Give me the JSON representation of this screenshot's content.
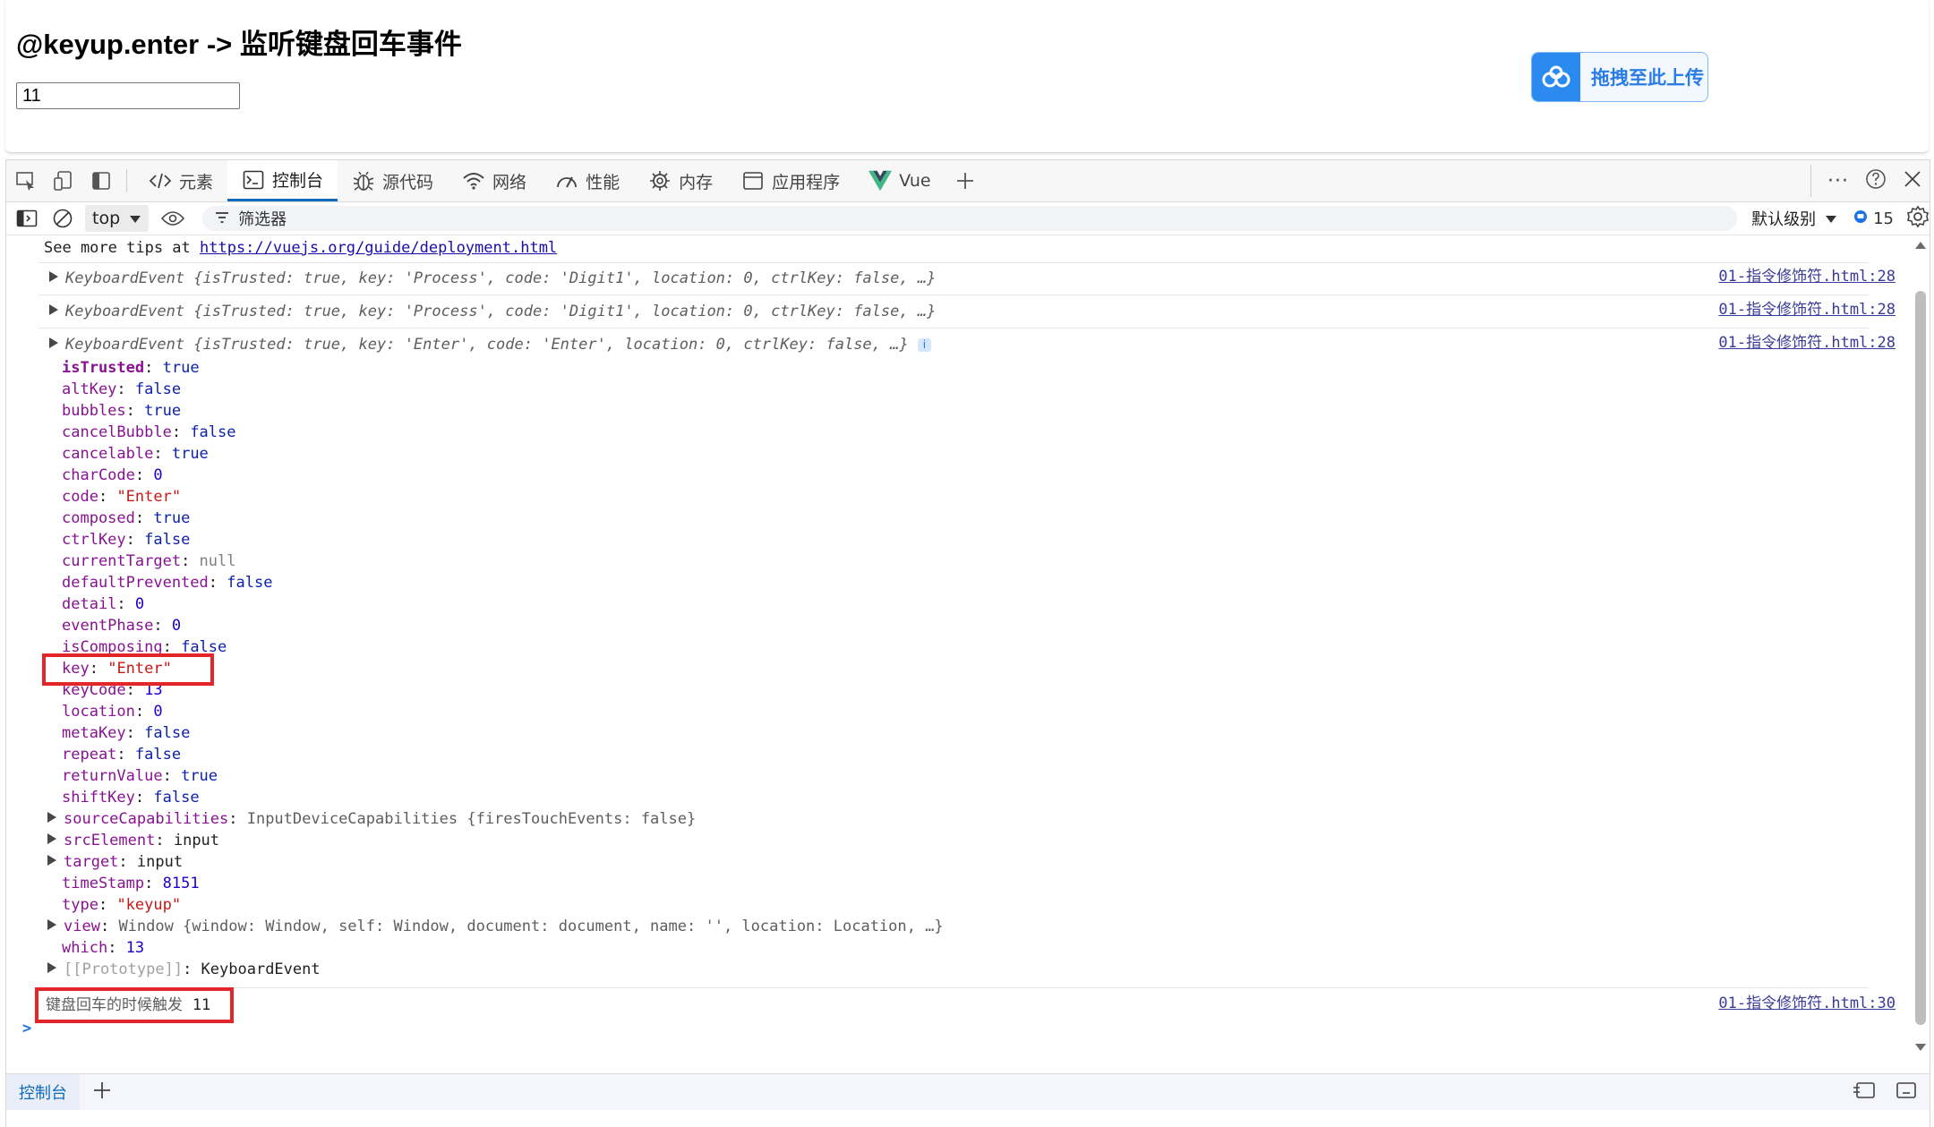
{
  "page": {
    "title": "@keyup.enter -> 监听键盘回车事件",
    "input_value": "11",
    "upload_label": "拖拽至此上传"
  },
  "devtools": {
    "tabs": [
      {
        "label": "元素",
        "icon": "code-icon"
      },
      {
        "label": "控制台",
        "icon": "console-icon",
        "active": true
      },
      {
        "label": "源代码",
        "icon": "bug-icon"
      },
      {
        "label": "网络",
        "icon": "wifi-icon"
      },
      {
        "label": "性能",
        "icon": "gauge-icon"
      },
      {
        "label": "内存",
        "icon": "chip-icon"
      },
      {
        "label": "应用程序",
        "icon": "app-icon"
      },
      {
        "label": "Vue",
        "icon": "vue-icon"
      }
    ],
    "context": "top",
    "filter_placeholder": "筛选器",
    "levels_label": "默认级别",
    "message_count": "15",
    "drawer_tab": "控制台"
  },
  "console": {
    "tip_prefix": "See more tips at ",
    "tip_link": "https://vuejs.org/guide/deployment.html",
    "events": [
      {
        "summary": "KeyboardEvent {isTrusted: true, key: 'Process', code: 'Digit1', location: 0, ctrlKey: false, …}",
        "source": "01-指令修饰符.html:28"
      },
      {
        "summary": "KeyboardEvent {isTrusted: true, key: 'Process', code: 'Digit1', location: 0, ctrlKey: false, …}",
        "source": "01-指令修饰符.html:28"
      },
      {
        "summary": "KeyboardEvent {isTrusted: true, key: 'Enter', code: 'Enter', location: 0, ctrlKey: false, …}",
        "source": "01-指令修饰符.html:28"
      }
    ],
    "props": [
      {
        "name": "isTrusted",
        "value": "true",
        "kind": "bool",
        "bold": true
      },
      {
        "name": "altKey",
        "value": "false",
        "kind": "bool"
      },
      {
        "name": "bubbles",
        "value": "true",
        "kind": "bool"
      },
      {
        "name": "cancelBubble",
        "value": "false",
        "kind": "bool"
      },
      {
        "name": "cancelable",
        "value": "true",
        "kind": "bool"
      },
      {
        "name": "charCode",
        "value": "0",
        "kind": "num"
      },
      {
        "name": "code",
        "value": "\"Enter\"",
        "kind": "str"
      },
      {
        "name": "composed",
        "value": "true",
        "kind": "bool"
      },
      {
        "name": "ctrlKey",
        "value": "false",
        "kind": "bool"
      },
      {
        "name": "currentTarget",
        "value": "null",
        "kind": "nul"
      },
      {
        "name": "defaultPrevented",
        "value": "false",
        "kind": "bool"
      },
      {
        "name": "detail",
        "value": "0",
        "kind": "num"
      },
      {
        "name": "eventPhase",
        "value": "0",
        "kind": "num"
      },
      {
        "name": "isComposing",
        "value": "false",
        "kind": "bool"
      },
      {
        "name": "key",
        "value": "\"Enter\"",
        "kind": "str"
      },
      {
        "name": "keyCode",
        "value": "13",
        "kind": "num"
      },
      {
        "name": "location",
        "value": "0",
        "kind": "num"
      },
      {
        "name": "metaKey",
        "value": "false",
        "kind": "bool"
      },
      {
        "name": "repeat",
        "value": "false",
        "kind": "bool"
      },
      {
        "name": "returnValue",
        "value": "true",
        "kind": "bool"
      },
      {
        "name": "shiftKey",
        "value": "false",
        "kind": "bool"
      },
      {
        "name": "sourceCapabilities",
        "value": "InputDeviceCapabilities {firesTouchEvents: false}",
        "kind": "obj",
        "expand": true
      },
      {
        "name": "srcElement",
        "value": "input",
        "kind": "plain",
        "expand": true
      },
      {
        "name": "target",
        "value": "input",
        "kind": "plain",
        "expand": true
      },
      {
        "name": "timeStamp",
        "value": "8151",
        "kind": "num"
      },
      {
        "name": "type",
        "value": "\"keyup\"",
        "kind": "str"
      },
      {
        "name": "view",
        "value": "Window {window: Window, self: Window, document: document, name: '', location: Location, …}",
        "kind": "obj",
        "expand": true
      },
      {
        "name": "which",
        "value": "13",
        "kind": "num"
      },
      {
        "name": "[[Prototype]]",
        "value": "KeyboardEvent",
        "kind": "plain",
        "expand": true,
        "dim": true
      }
    ],
    "log_text": "键盘回车的时候触发",
    "log_value": "11",
    "log_source": "01-指令修饰符.html:30",
    "prompt": ">"
  }
}
